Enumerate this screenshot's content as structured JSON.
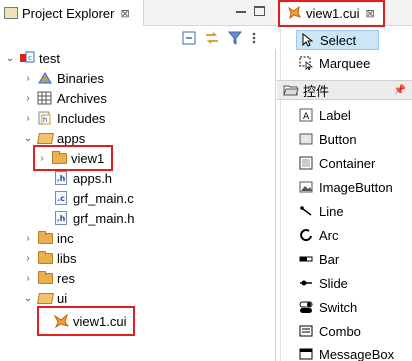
{
  "explorer": {
    "tab_title": "Project Explorer",
    "tab_close": "⊠",
    "tree": [
      {
        "label": "test",
        "expanded": true,
        "type": "project"
      },
      {
        "label": "Binaries",
        "expanded": false,
        "type": "binaries"
      },
      {
        "label": "Archives",
        "expanded": false,
        "type": "archives"
      },
      {
        "label": "Includes",
        "expanded": false,
        "type": "includes"
      },
      {
        "label": "apps",
        "expanded": true,
        "type": "folder"
      },
      {
        "label": "view1",
        "expanded": false,
        "type": "folder",
        "highlighted": true
      },
      {
        "label": "apps.h",
        "type": "file-h"
      },
      {
        "label": "grf_main.c",
        "type": "file-c"
      },
      {
        "label": "grf_main.h",
        "type": "file-h"
      },
      {
        "label": "inc",
        "expanded": false,
        "type": "folder"
      },
      {
        "label": "libs",
        "expanded": false,
        "type": "folder"
      },
      {
        "label": "res",
        "expanded": false,
        "type": "folder"
      },
      {
        "label": "ui",
        "expanded": true,
        "type": "folder"
      },
      {
        "label": "view1.cui",
        "type": "cui",
        "highlighted": true
      }
    ]
  },
  "editor": {
    "tab_title": "view1.cui",
    "tab_close": "⊠"
  },
  "palette": {
    "tools": [
      {
        "label": "Select",
        "selected": true
      },
      {
        "label": "Marquee",
        "selected": false
      }
    ],
    "drawer_label": "控件",
    "items": [
      {
        "label": "Label"
      },
      {
        "label": "Button"
      },
      {
        "label": "Container"
      },
      {
        "label": "ImageButton"
      },
      {
        "label": "Line"
      },
      {
        "label": "Arc"
      },
      {
        "label": "Bar"
      },
      {
        "label": "Slide"
      },
      {
        "label": "Switch"
      },
      {
        "label": "Combo"
      },
      {
        "label": "MessageBox"
      }
    ]
  },
  "colors": {
    "highlight": "#e02020",
    "selection": "#cde6f7",
    "folder": "#e9b04f"
  }
}
